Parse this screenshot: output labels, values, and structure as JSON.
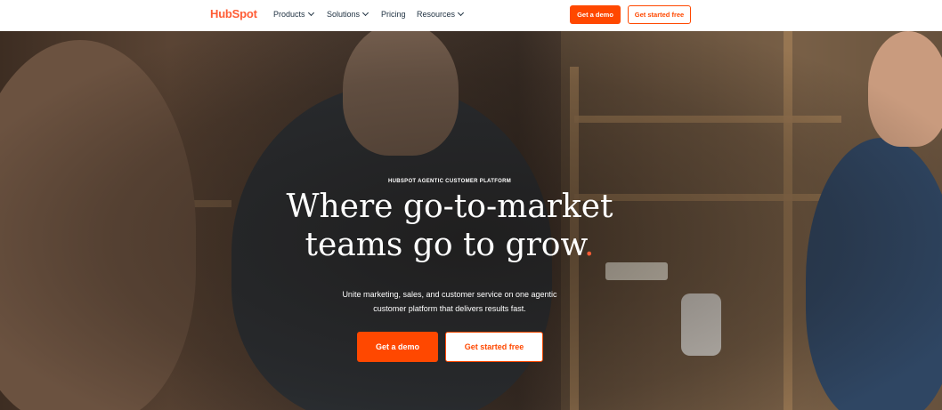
{
  "nav": {
    "logo": "HubSpot",
    "items": [
      {
        "label": "Products",
        "has_menu": true
      },
      {
        "label": "Solutions",
        "has_menu": true
      },
      {
        "label": "Pricing",
        "has_menu": false
      },
      {
        "label": "Resources",
        "has_menu": true
      }
    ],
    "demo_label": "Get a demo",
    "free_label": "Get started free"
  },
  "hero": {
    "eyebrow": "HUBSPOT AGENTIC CUSTOMER PLATFORM",
    "headline_line1": "Where go-to-market",
    "headline_line2": "teams go to grow",
    "headline_dot": ".",
    "sub_line1": "Unite marketing, sales, and customer service on one agentic",
    "sub_line2": "customer platform that delivers results fast.",
    "demo_label": "Get a demo",
    "free_label": "Get started free"
  },
  "colors": {
    "brand_orange": "#ff4800",
    "logo_orange": "#ff5c35",
    "text_dark": "#213343"
  },
  "icons": [
    "chevron-down-icon"
  ]
}
